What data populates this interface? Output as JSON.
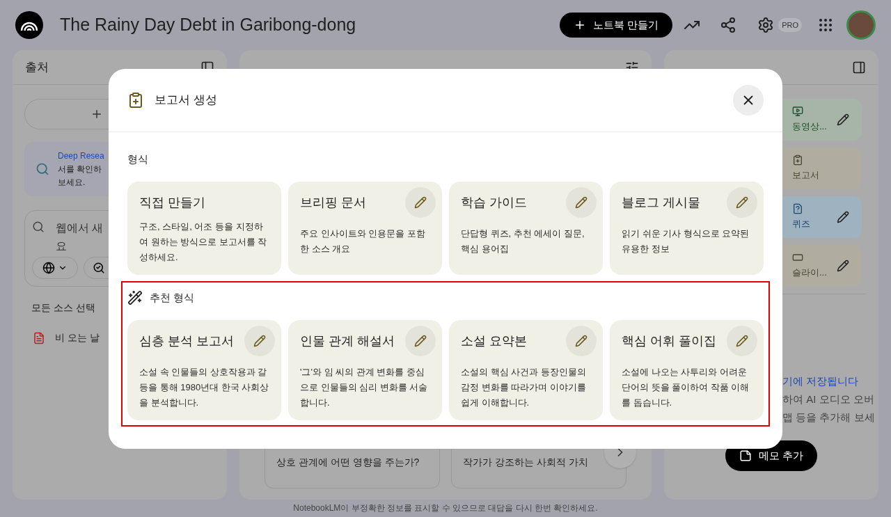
{
  "app": {
    "title": "The Rainy Day Debt in Garibong-dong",
    "new_notebook_button": "노트북 만들기",
    "plan_badge": "PRO"
  },
  "sources_panel": {
    "title": "출처",
    "deep_research_lines": [
      "Deep Resea",
      "서를 확인하",
      "보세요."
    ],
    "web_search_lines": [
      "웹에서 새",
      "요"
    ],
    "select_all": "모든 소스 선택",
    "sources": [
      {
        "name": "비 오는 날"
      }
    ]
  },
  "chat_panel": {
    "suggestions": [
      "상호 관계에 어떤 영향을 주는가?",
      "작가가 강조하는 사회적 가치"
    ]
  },
  "studio_panel": {
    "tiles": [
      {
        "label": "동영상...",
        "kind": "video",
        "editable": true
      },
      {
        "label": "보고서",
        "kind": "report",
        "editable": false
      },
      {
        "label": "퀴즈",
        "kind": "quiz",
        "editable": true
      },
      {
        "label": "슬라이...",
        "kind": "slides",
        "editable": true
      }
    ],
    "notes_lines": [
      "기에 저장됩니다",
      "하여 AI 오디오 오버",
      "맵 등을 추가해 보세"
    ],
    "add_note_button": "메모 추가"
  },
  "footer": "NotebookLM이 부정확한 정보를 표시할 수 있으므로 대답을 다시 한번 확인하세요.",
  "dialog": {
    "title": "보고서 생성",
    "sections": [
      {
        "title": "형식",
        "kind": "plain",
        "highlighted": false,
        "cards": [
          {
            "title": "직접 만들기",
            "description": "구조, 스타일, 어조 등을 지정하여 원하는 방식으로 보고서를 작성하세요.",
            "editable": false
          },
          {
            "title": "브리핑 문서",
            "description": "주요 인사이트와 인용문을 포함한 소스 개요",
            "editable": true
          },
          {
            "title": "학습 가이드",
            "description": "단답형 퀴즈, 추천 에세이 질문, 핵심 용어집",
            "editable": true
          },
          {
            "title": "블로그 게시물",
            "description": "읽기 쉬운 기사 형식으로 요약된 유용한 정보",
            "editable": true
          }
        ]
      },
      {
        "title": "추천 형식",
        "kind": "suggested",
        "highlighted": true,
        "cards": [
          {
            "title": "심층 분석 보고서",
            "description": "소설 속 인물들의 상호작용과 갈등을 통해 1980년대 한국 사회상을 분석합니다.",
            "editable": true
          },
          {
            "title": "인물 관계 해설서",
            "description": "'그'와 임 씨의 관계 변화를 중심으로 인물들의 심리 변화를 서술합니다.",
            "editable": true
          },
          {
            "title": "소설 요약본",
            "description": "소설의 핵심 사건과 등장인물의 감정 변화를 따라가며 이야기를 쉽게 이해합니다.",
            "editable": true
          },
          {
            "title": "핵심 어휘 풀이집",
            "description": "소설에 나오는 사투리와 어려운 단어의 뜻을 풀이하여 작품 이해를 돕습니다.",
            "editable": true
          }
        ]
      }
    ]
  }
}
